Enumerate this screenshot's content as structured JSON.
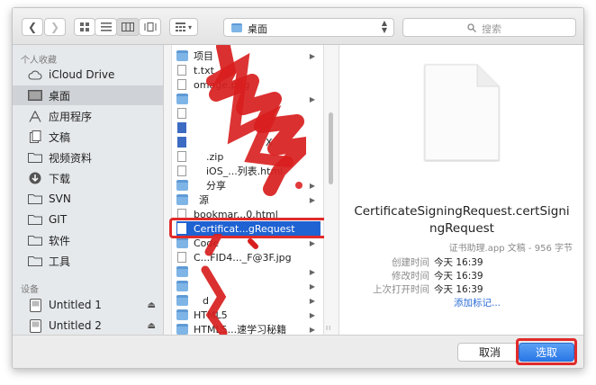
{
  "toolbar": {
    "back_icon": "chevron-left",
    "forward_icon": "chevron-right",
    "view_icons": [
      "icon-view",
      "list-view",
      "column-view",
      "coverflow-view"
    ],
    "arrange_icon": "arrange-grid",
    "location": "桌面",
    "search_placeholder": "搜索"
  },
  "sidebar": {
    "favorites_header": "个人收藏",
    "favorites": [
      {
        "label": "iCloud Drive",
        "icon": "cloud-icon"
      },
      {
        "label": "桌面",
        "icon": "desktop-icon",
        "selected": true
      },
      {
        "label": "应用程序",
        "icon": "applications-icon"
      },
      {
        "label": "文稿",
        "icon": "documents-icon"
      },
      {
        "label": "视频资料",
        "icon": "folder-icon"
      },
      {
        "label": "下载",
        "icon": "downloads-icon"
      },
      {
        "label": "SVN",
        "icon": "folder-icon"
      },
      {
        "label": "GIT",
        "icon": "folder-icon"
      },
      {
        "label": "软件",
        "icon": "folder-icon"
      },
      {
        "label": "工具",
        "icon": "folder-icon"
      }
    ],
    "devices_header": "设备",
    "devices": [
      {
        "label": "Untitled 1",
        "icon": "disk-icon"
      },
      {
        "label": "Untitled 2",
        "icon": "disk-icon"
      }
    ]
  },
  "files": [
    {
      "name": "项目",
      "kind": "folder",
      "arrow": true
    },
    {
      "name": "t.txt",
      "kind": "file"
    },
    {
      "name": "omage.png",
      "kind": "file"
    },
    {
      "name": "",
      "kind": "folder",
      "arrow": true
    },
    {
      "name": "",
      "kind": "file"
    },
    {
      "name": "",
      "kind": "file"
    },
    {
      "name": "X",
      "kind": "file"
    },
    {
      "name": ".zip",
      "kind": "file"
    },
    {
      "name": "iOS_...列表.html",
      "kind": "file"
    },
    {
      "name": "分享",
      "kind": "folder",
      "arrow": true,
      "tag": "#e03a3a"
    },
    {
      "name": "源",
      "kind": "folder",
      "arrow": true
    },
    {
      "name": "bookmar...0.html",
      "kind": "file"
    },
    {
      "name": "Certificat...gRequest",
      "kind": "file",
      "selected": true
    },
    {
      "name": "Code",
      "kind": "folder",
      "arrow": true
    },
    {
      "name": "C...FID4..._F@3F.jpg",
      "kind": "file"
    },
    {
      "name": "",
      "kind": "folder",
      "arrow": true
    },
    {
      "name": "",
      "kind": "folder",
      "arrow": true
    },
    {
      "name": "d",
      "kind": "folder",
      "arrow": true
    },
    {
      "name": "HTML5",
      "kind": "folder",
      "arrow": true
    },
    {
      "name": "HTML5...速学习秘籍",
      "kind": "folder",
      "arrow": true
    }
  ],
  "preview": {
    "filename": "CertificateSigningRequest.certSigningRequest",
    "kind_size": "证书助理.app 文稿 - 956 字节",
    "details": [
      {
        "key": "创建时间",
        "value": "今天 16:39"
      },
      {
        "key": "修改时间",
        "value": "今天 16:39"
      },
      {
        "key": "上次打开时间",
        "value": "今天 16:39"
      }
    ],
    "add_tags": "添加标记..."
  },
  "buttons": {
    "cancel": "取消",
    "choose": "选取"
  },
  "colors": {
    "selection": "#1f62d2",
    "highlight": "#e12b2b",
    "tag_red": "#e03a3a"
  },
  "column_grip": "II"
}
